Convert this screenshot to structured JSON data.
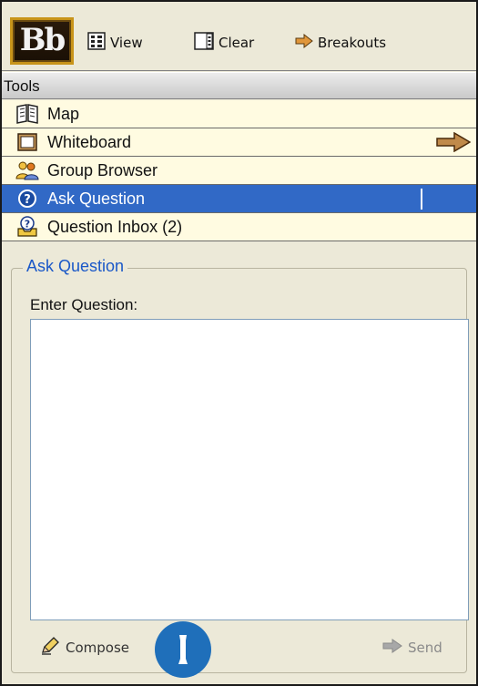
{
  "logo": {
    "text": "Bb"
  },
  "toolbar": {
    "view_label": "View",
    "clear_label": "Clear",
    "breakouts_label": "Breakouts"
  },
  "tools": {
    "header": "Tools",
    "items": [
      {
        "label": "Map",
        "icon": "book-icon"
      },
      {
        "label": "Whiteboard",
        "icon": "whiteboard-icon"
      },
      {
        "label": "Group Browser",
        "icon": "group-icon"
      },
      {
        "label": "Ask Question",
        "icon": "question-icon",
        "selected": true
      },
      {
        "label": "Question Inbox (2)",
        "icon": "question-inbox-icon"
      }
    ]
  },
  "ask_question": {
    "title": "Ask Question",
    "enter_label": "Enter Question:",
    "input_value": ""
  },
  "actions": {
    "compose_label": "Compose",
    "send_label": "Send"
  },
  "colors": {
    "selection": "#3169c6",
    "panel_bg": "#ece9d8",
    "row_bg": "#fffbe1",
    "title_blue": "#1a58c8",
    "callout": "#1f6fba"
  }
}
